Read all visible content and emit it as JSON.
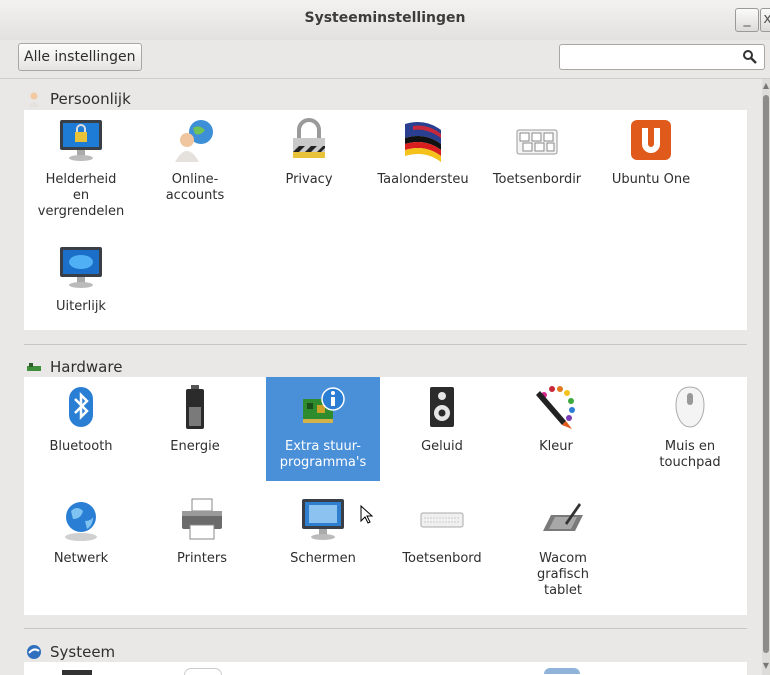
{
  "window": {
    "title": "Systeeminstellingen",
    "minimize_label": "_",
    "close_label": "x"
  },
  "toolbar": {
    "all_settings_label": "Alle instellingen",
    "search_value": "",
    "search_placeholder": ""
  },
  "sections": [
    {
      "title": "Persoonlijk",
      "icon": "person-icon",
      "items": [
        {
          "label": "Helderheid\nen\nvergrendelen",
          "icon": "brightness-lock-icon"
        },
        {
          "label": "Online-\naccounts",
          "icon": "online-accounts-icon"
        },
        {
          "label": "Privacy",
          "icon": "privacy-lock-icon"
        },
        {
          "label": "Taalondersteu",
          "icon": "language-flag-icon"
        },
        {
          "label": "Toetsenbordir",
          "icon": "keyboard-layout-icon"
        },
        {
          "label": "Ubuntu One",
          "icon": "ubuntu-one-icon"
        },
        {
          "label": "Uiterlijk",
          "icon": "appearance-monitor-icon"
        }
      ]
    },
    {
      "title": "Hardware",
      "icon": "hardware-board-icon",
      "items": [
        {
          "label": "Bluetooth",
          "icon": "bluetooth-icon"
        },
        {
          "label": "Energie",
          "icon": "battery-icon"
        },
        {
          "label": "Extra stuur-\nprogramma's",
          "icon": "additional-drivers-icon",
          "selected": true
        },
        {
          "label": "Geluid",
          "icon": "speaker-icon"
        },
        {
          "label": "Kleur",
          "icon": "color-palette-icon"
        },
        {
          "label": "Muis en\ntouchpad",
          "icon": "mouse-icon"
        },
        {
          "label": "Netwerk",
          "icon": "network-globe-icon"
        },
        {
          "label": "Printers",
          "icon": "printer-icon"
        },
        {
          "label": "Schermen",
          "icon": "displays-icon"
        },
        {
          "label": "Toetsenbord",
          "icon": "keyboard-icon"
        },
        {
          "label": "Wacom\ngrafisch\ntablet",
          "icon": "wacom-tablet-icon"
        }
      ]
    },
    {
      "title": "Systeem",
      "icon": "system-icon",
      "items": []
    }
  ],
  "colors": {
    "selection": "#4a90d9",
    "window_bg": "#e9e8e6",
    "panel_bg": "#ffffff"
  }
}
